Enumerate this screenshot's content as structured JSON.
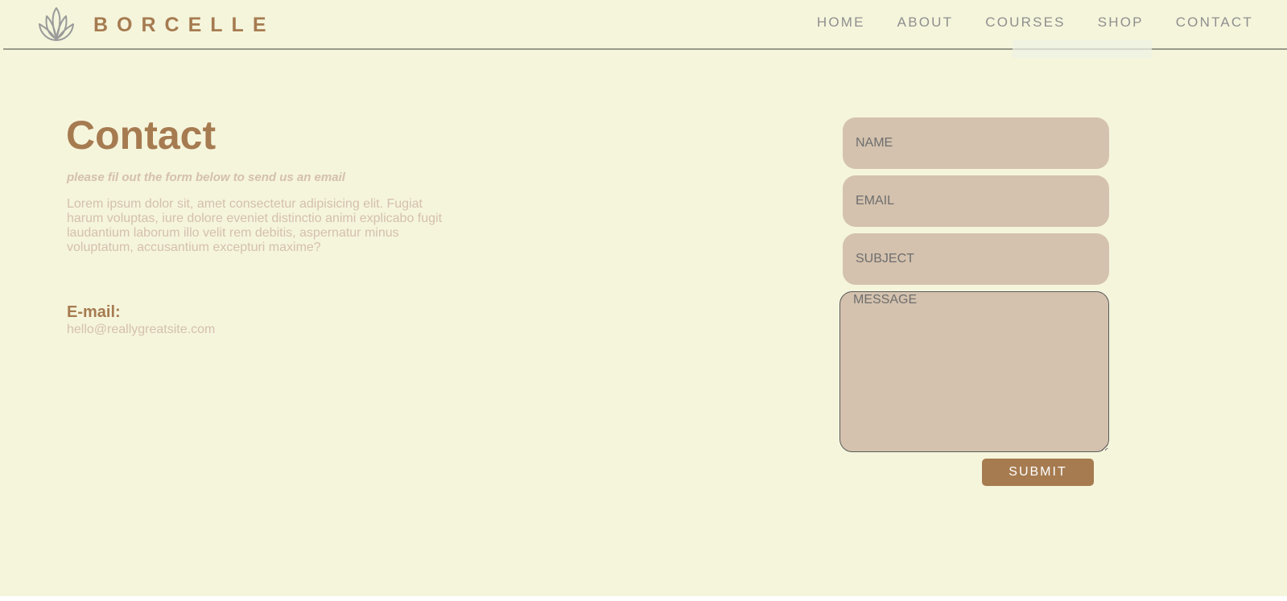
{
  "header": {
    "brand": "BORCELLE",
    "nav": [
      "HOME",
      "ABOUT",
      "COURSES",
      "SHOP",
      "CONTACT"
    ]
  },
  "main": {
    "title": "Contact",
    "subtitle": "please fil out the form below to send us an email",
    "body": "Lorem ipsum dolor sit, amet consectetur adipisicing elit. Fugiat harum voluptas, iure dolore eveniet distinctio animi explicabo fugit laudantium laborum illo velit rem debitis, aspernatur minus voluptatum, accusantium excepturi maxime?",
    "email_label": "E-mail:",
    "email_value": "hello@reallygreatsite.com"
  },
  "form": {
    "name_placeholder": "NAME",
    "email_placeholder": "EMAIL",
    "subject_placeholder": "SUBJECT",
    "message_placeholder": "MESSAGE",
    "submit_label": "SUBMIT"
  },
  "colors": {
    "background": "#f5f5dc",
    "accent": "#a67b50",
    "field": "#d4c2ae",
    "muted_text": "#d5c0ad",
    "nav_text": "#8f8f8f"
  },
  "icons": {
    "logo": "lotus-icon"
  }
}
